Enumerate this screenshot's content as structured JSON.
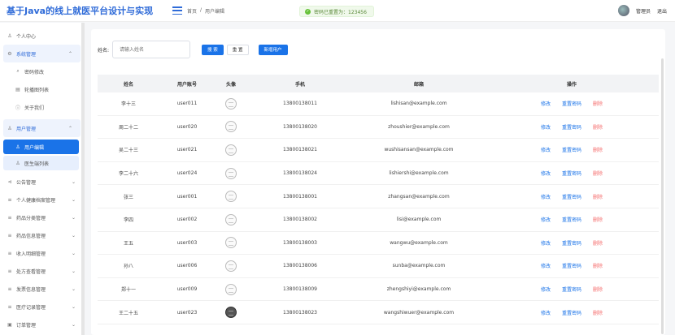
{
  "header": {
    "app_title": "基于Java的线上就医平台设计与实现",
    "breadcrumb": [
      "首页",
      "/",
      "用户编辑"
    ],
    "toast": "密码已重置为：123456",
    "user": "管理员",
    "logout": "退出"
  },
  "sidebar": {
    "items": [
      {
        "icon": "♙",
        "label": "个人中心"
      },
      {
        "icon": "⚙",
        "label": "系统管理",
        "chevron": "⌃"
      },
      {
        "icon": "⌕",
        "label": "密码修改"
      },
      {
        "icon": "▤",
        "label": "轮播图列表"
      },
      {
        "icon": "ⓘ",
        "label": "关于我们"
      },
      {
        "icon": "♙",
        "label": "用户管理",
        "chevron": "⌃"
      },
      {
        "icon": "♙",
        "label": "用户编辑"
      },
      {
        "icon": "♙",
        "label": "医生端列表"
      },
      {
        "icon": "⊲",
        "label": "公告管理",
        "chevron": "⌄"
      },
      {
        "icon": "≡",
        "label": "个人健康档案管理",
        "chevron": "⌄"
      },
      {
        "icon": "≡",
        "label": "药品分类管理",
        "chevron": "⌄"
      },
      {
        "icon": "≡",
        "label": "药品信息管理",
        "chevron": "⌄"
      },
      {
        "icon": "≡",
        "label": "收入明细管理",
        "chevron": "⌄"
      },
      {
        "icon": "≡",
        "label": "处方查看管理",
        "chevron": "⌄"
      },
      {
        "icon": "≡",
        "label": "发票信息管理",
        "chevron": "⌄"
      },
      {
        "icon": "≡",
        "label": "医疗记录管理",
        "chevron": "⌄"
      },
      {
        "icon": "▣",
        "label": "订单管理",
        "chevron": "⌄"
      }
    ]
  },
  "search": {
    "label": "姓名:",
    "placeholder": "请输入姓名",
    "search_btn": "搜 索",
    "reset_btn": "重 置",
    "add_btn": "新增用户"
  },
  "table": {
    "headers": [
      "姓名",
      "用户账号",
      "头像",
      "手机",
      "邮箱",
      "操作"
    ],
    "ops": {
      "edit": "修改",
      "reset": "重置密码",
      "delete": "删除"
    },
    "rows": [
      {
        "name": "李十三",
        "account": "user011",
        "phone": "13800138011",
        "email": "lishisan@example.com"
      },
      {
        "name": "周二十二",
        "account": "user020",
        "phone": "13800138020",
        "email": "zhoushier@example.com"
      },
      {
        "name": "吴二十三",
        "account": "user021",
        "phone": "13800138021",
        "email": "wushisansan@example.com"
      },
      {
        "name": "李二十六",
        "account": "user024",
        "phone": "13800138024",
        "email": "lishiershi@example.com"
      },
      {
        "name": "张三",
        "account": "user001",
        "phone": "13800138001",
        "email": "zhangsan@example.com"
      },
      {
        "name": "李四",
        "account": "user002",
        "phone": "13800138002",
        "email": "lisi@example.com"
      },
      {
        "name": "王五",
        "account": "user003",
        "phone": "13800138003",
        "email": "wangwu@example.com"
      },
      {
        "name": "孙八",
        "account": "user006",
        "phone": "13800138006",
        "email": "sunba@example.com"
      },
      {
        "name": "郑十一",
        "account": "user009",
        "phone": "13800138009",
        "email": "zhengshiyi@example.com"
      },
      {
        "name": "王二十五",
        "account": "user023",
        "phone": "13800138023",
        "email": "wangshiwuer@example.com"
      }
    ]
  }
}
